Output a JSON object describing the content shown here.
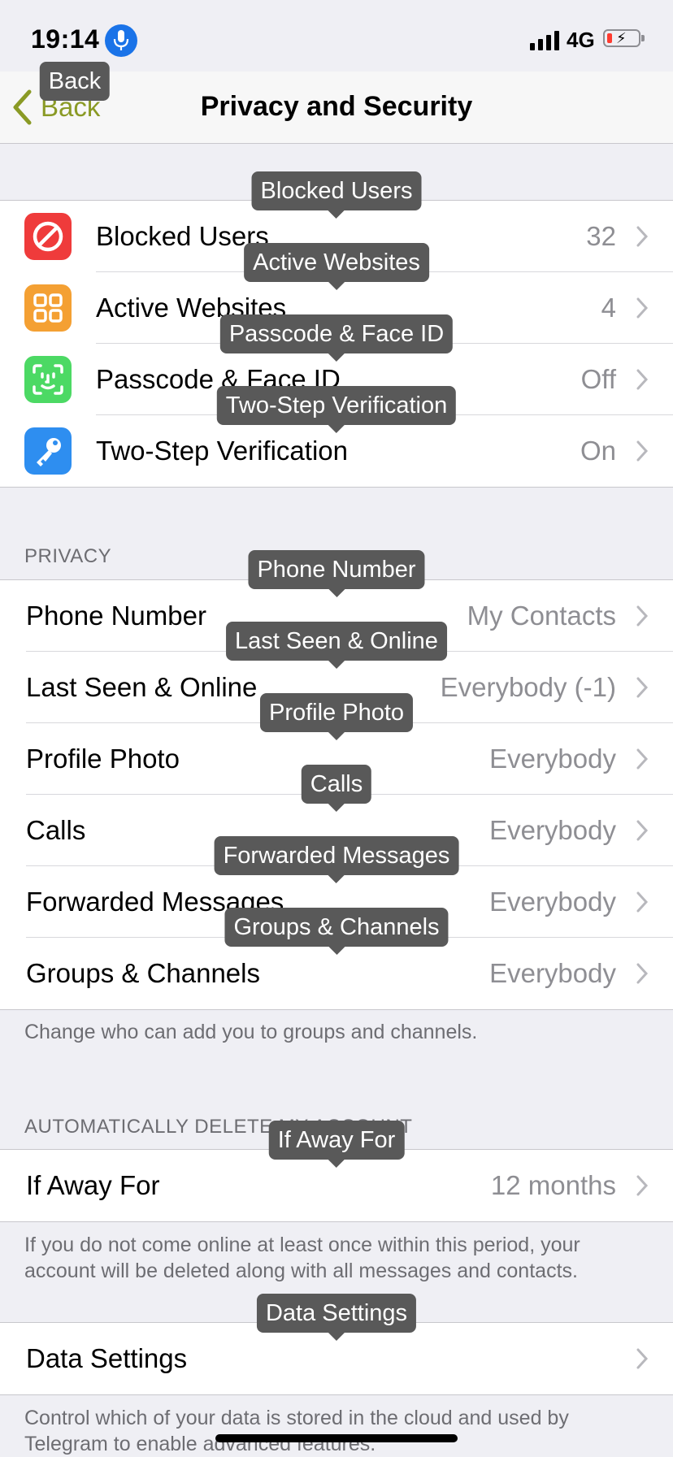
{
  "status_bar": {
    "time": "19:14",
    "network": "4G"
  },
  "nav": {
    "back_label": "Back",
    "title": "Privacy and Security"
  },
  "security_items": [
    {
      "label": "Blocked Users",
      "value": "32",
      "icon": "block-icon",
      "color": "#ef3b3b"
    },
    {
      "label": "Active Websites",
      "value": "4",
      "icon": "grid-icon",
      "color": "#f4a033"
    },
    {
      "label": "Passcode & Face ID",
      "value": "Off",
      "icon": "face-id-icon",
      "color": "#4cd964"
    },
    {
      "label": "Two-Step Verification",
      "value": "On",
      "icon": "key-icon",
      "color": "#2e8ef0"
    }
  ],
  "privacy": {
    "header": "PRIVACY",
    "items": [
      {
        "label": "Phone Number",
        "value": "My Contacts"
      },
      {
        "label": "Last Seen & Online",
        "value": "Everybody (-1)"
      },
      {
        "label": "Profile Photo",
        "value": "Everybody"
      },
      {
        "label": "Calls",
        "value": "Everybody"
      },
      {
        "label": "Forwarded Messages",
        "value": "Everybody"
      },
      {
        "label": "Groups & Channels",
        "value": "Everybody"
      }
    ],
    "footer": "Change who can add you to groups and channels."
  },
  "auto_delete": {
    "header": "AUTOMATICALLY DELETE MY ACCOUNT",
    "item": {
      "label": "If Away For",
      "value": "12 months"
    },
    "footer": "If you do not come online at least once within this period, your account will be deleted along with all messages and contacts."
  },
  "data": {
    "item": {
      "label": "Data Settings",
      "value": ""
    },
    "footer": "Control which of your data is stored in the cloud and used by Telegram to enable advanced features."
  },
  "tooltips": {
    "back": "Back",
    "blocked": "Blocked Users",
    "websites": "Active Websites",
    "passcode": "Passcode & Face ID",
    "two_step": "Two-Step Verification",
    "phone": "Phone Number",
    "last_seen": "Last Seen & Online",
    "profile_photo": "Profile Photo",
    "calls": "Calls",
    "forwarded": "Forwarded Messages",
    "groups": "Groups & Channels",
    "away": "If Away For",
    "data": "Data Settings"
  },
  "colors": {
    "accent": "#8a9a25",
    "background": "#efeff4",
    "tooltip": "#595959"
  }
}
